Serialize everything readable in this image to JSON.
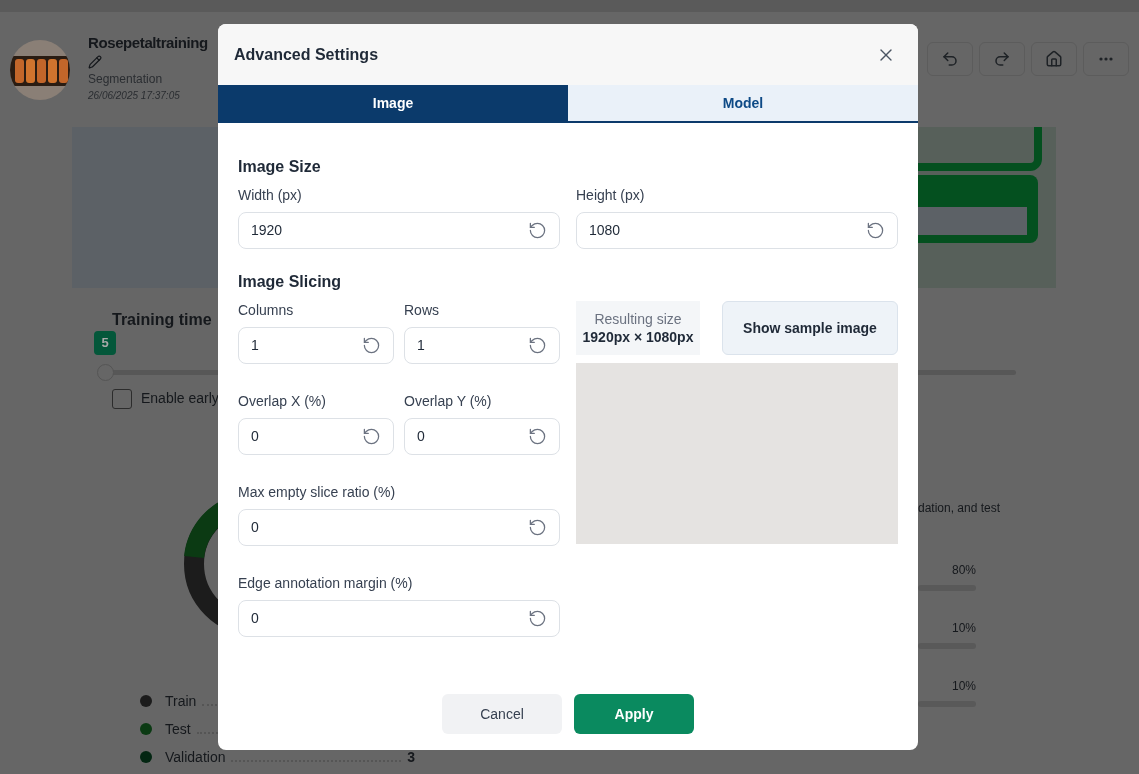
{
  "project": {
    "title": "Rosepetaltraining",
    "subtitle": "Segmentation",
    "date": "26/06/2025 17:37:05"
  },
  "training": {
    "title": "Training time",
    "slider": {
      "value": "5",
      "level": 0
    },
    "early_stop": {
      "label": "Enable early",
      "checked": false
    }
  },
  "split": {
    "description": "dation, and test",
    "legend": [
      {
        "name": "Train",
        "color": "#1c1c1c"
      },
      {
        "name": "Test",
        "color": "#0b3a13"
      },
      {
        "name": "Validation",
        "color": "#032612",
        "value": "3"
      }
    ],
    "shares": [
      "80%",
      "10%",
      "10%"
    ]
  },
  "dialog": {
    "title": "Advanced Settings",
    "tabs": [
      {
        "label": "Image",
        "selected": true
      },
      {
        "label": "Model",
        "selected": false
      }
    ],
    "image_size": {
      "heading": "Image Size",
      "fields": [
        {
          "label": "Width (px)",
          "value": "1920"
        },
        {
          "label": "Height (px)",
          "value": "1080"
        }
      ]
    },
    "image_slicing": {
      "heading": "Image Slicing",
      "pair_fields": [
        {
          "label": "Columns",
          "value": "1"
        },
        {
          "label": "Rows",
          "value": "1"
        },
        {
          "label": "Overlap X (%)",
          "value": "0"
        },
        {
          "label": "Overlap Y (%)",
          "value": "0"
        }
      ],
      "wide_fields": [
        {
          "label": "Max empty slice ratio (%)",
          "value": "0"
        },
        {
          "label": "Edge annotation margin (%)",
          "value": "0"
        }
      ],
      "result": {
        "label": "Resulting size",
        "value": "1920px × 1080px"
      },
      "sample_button": "Show sample image"
    },
    "buttons": [
      {
        "label": "Cancel",
        "kind": "secondary"
      },
      {
        "label": "Apply",
        "kind": "primary"
      }
    ]
  }
}
